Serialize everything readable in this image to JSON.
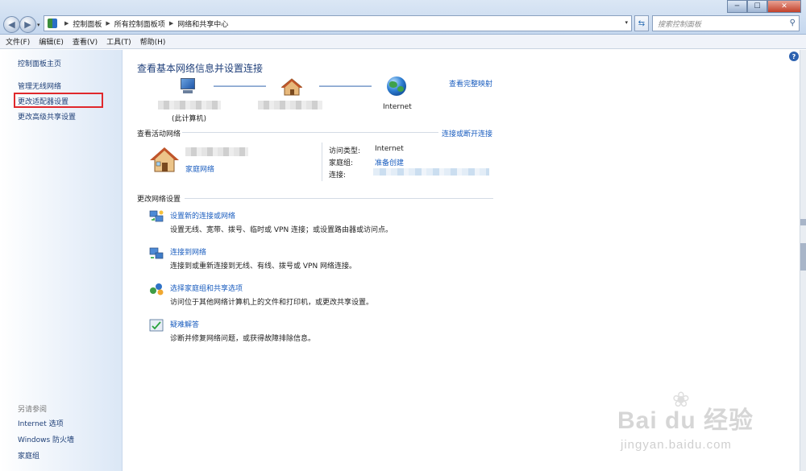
{
  "window": {
    "min_glyph": "─",
    "max_glyph": "☐",
    "close_glyph": "✕"
  },
  "address_bar": {
    "crumbs": [
      "控制面板",
      "所有控制面板项",
      "网络和共享中心"
    ],
    "search_placeholder": "搜索控制面板"
  },
  "menu": [
    "文件(F)",
    "编辑(E)",
    "查看(V)",
    "工具(T)",
    "帮助(H)"
  ],
  "sidebar": {
    "home": "控制面板主页",
    "items": [
      {
        "label": "管理无线网络"
      },
      {
        "label": "更改适配器设置",
        "highlighted": true
      },
      {
        "label": "更改高级共享设置"
      }
    ],
    "see_also_header": "另请参阅",
    "see_also": [
      "Internet 选项",
      "Windows 防火墙",
      "家庭组"
    ]
  },
  "main": {
    "title": "查看基本网络信息并设置连接",
    "full_map_link": "查看完整映射",
    "map": {
      "this_pc_label": "(此计算机)",
      "internet_label": "Internet"
    },
    "active_networks": {
      "header": "查看活动网络",
      "connect_link": "连接或断开连接",
      "network_type": "家庭网络",
      "access_type_key": "访问类型:",
      "access_type_value": "Internet",
      "homegroup_key": "家庭组:",
      "homegroup_value": "准备创建",
      "connection_key": "连接:"
    },
    "settings": {
      "header": "更改网络设置",
      "tasks": [
        {
          "title": "设置新的连接或网络",
          "desc": "设置无线、宽带、拨号、临时或 VPN 连接；或设置路由器或访问点。",
          "icon": "new-connection-icon"
        },
        {
          "title": "连接到网络",
          "desc": "连接到或重新连接到无线、有线、拨号或 VPN 网络连接。",
          "icon": "connect-network-icon"
        },
        {
          "title": "选择家庭组和共享选项",
          "desc": "访问位于其他网络计算机上的文件和打印机，或更改共享设置。",
          "icon": "homegroup-icon"
        },
        {
          "title": "疑难解答",
          "desc": "诊断并修复网络问题，或获得故障排除信息。",
          "icon": "troubleshoot-icon"
        }
      ]
    }
  },
  "watermark": {
    "logo": "Bai du 经验",
    "url": "jingyan.baidu.com"
  },
  "colors": {
    "link": "#1a5dbf",
    "title": "#1f3f7a",
    "highlight_box": "#e0282c"
  }
}
